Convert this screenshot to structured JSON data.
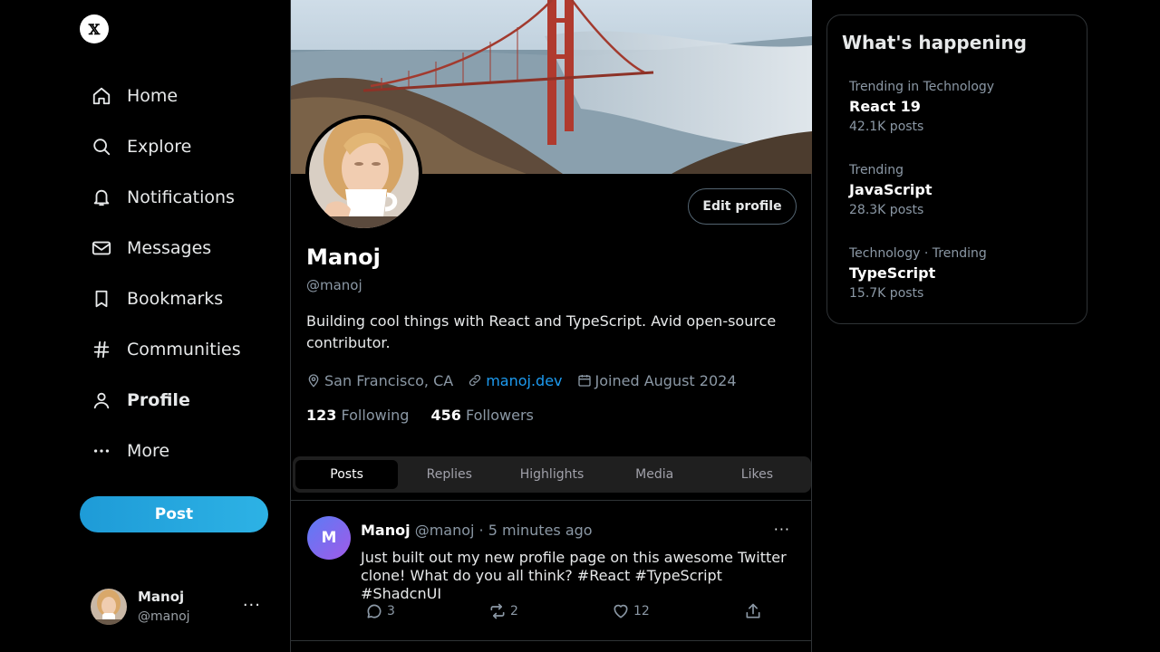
{
  "logo": "𝕏",
  "nav": [
    {
      "label": "Home",
      "icon": "home-icon"
    },
    {
      "label": "Explore",
      "icon": "search-icon"
    },
    {
      "label": "Notifications",
      "icon": "bell-icon"
    },
    {
      "label": "Messages",
      "icon": "mail-icon"
    },
    {
      "label": "Bookmarks",
      "icon": "bookmark-icon"
    },
    {
      "label": "Communities",
      "icon": "hash-icon"
    },
    {
      "label": "Profile",
      "icon": "user-icon"
    },
    {
      "label": "More",
      "icon": "more-dots-icon"
    }
  ],
  "post_button": "Post",
  "account": {
    "name": "Manoj",
    "handle": "@manoj",
    "menu": "···"
  },
  "profile": {
    "edit_label": "Edit profile",
    "name": "Manoj",
    "handle": "@manoj",
    "bio": "Building cool things with React and TypeScript. Avid open-source contributor.",
    "location": "San Francisco, CA",
    "website": "manoj.dev",
    "joined": "Joined August 2024",
    "following_count": "123",
    "following_label": "Following",
    "followers_count": "456",
    "followers_label": "Followers"
  },
  "tabs": [
    "Posts",
    "Replies",
    "Highlights",
    "Media",
    "Likes"
  ],
  "active_tab": "Posts",
  "post": {
    "avatar_letter": "M",
    "name": "Manoj",
    "meta": "@manoj · 5 minutes ago",
    "more": "···",
    "text": "Just built out my new profile page on this awesome Twitter clone! What do you all think? #React #TypeScript #ShadcnUI",
    "replies": "3",
    "reposts": "2",
    "likes": "12"
  },
  "trends": {
    "title": "What's happening",
    "items": [
      {
        "category": "Trending in Technology",
        "topic": "React 19",
        "count": "42.1K posts"
      },
      {
        "category": "Trending",
        "topic": "JavaScript",
        "count": "28.3K posts"
      },
      {
        "category": "Technology · Trending",
        "topic": "TypeScript",
        "count": "15.7K posts"
      }
    ]
  },
  "colors": {
    "accent": "#1d9bf0",
    "post_button": "#1e9bd7",
    "background": "#000000"
  }
}
